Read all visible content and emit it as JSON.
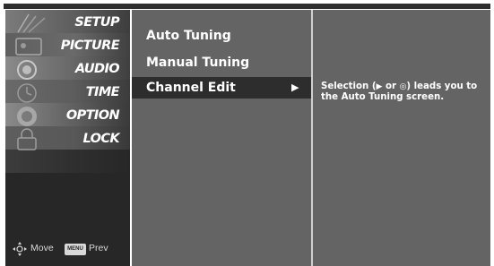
{
  "categories": [
    {
      "label": "SETUP",
      "icon": "antenna-icon"
    },
    {
      "label": "PICTURE",
      "icon": "picture-icon"
    },
    {
      "label": "AUDIO",
      "icon": "speaker-icon"
    },
    {
      "label": "TIME",
      "icon": "clock-icon"
    },
    {
      "label": "OPTION",
      "icon": "option-icon"
    },
    {
      "label": "LOCK",
      "icon": "lock-icon"
    }
  ],
  "footer": {
    "move_label": "Move",
    "menu_key": "MENU",
    "prev_label": "Prev"
  },
  "submenu": {
    "items": [
      {
        "label": "Auto Tuning"
      },
      {
        "label": "Manual Tuning"
      },
      {
        "label": "Channel Edit",
        "arrow": "▶"
      }
    ],
    "selected_index": 2
  },
  "help": {
    "prefix": "Selection (",
    "arrow_glyph": "▶",
    "middle": " or ",
    "ok_glyph": "◎",
    "suffix": ") leads you to the Auto Tuning screen."
  },
  "colors": {
    "panel": "#646464",
    "left_panel": "#272727",
    "selected_row": "#2d2d2d",
    "text": "#ffffff"
  }
}
